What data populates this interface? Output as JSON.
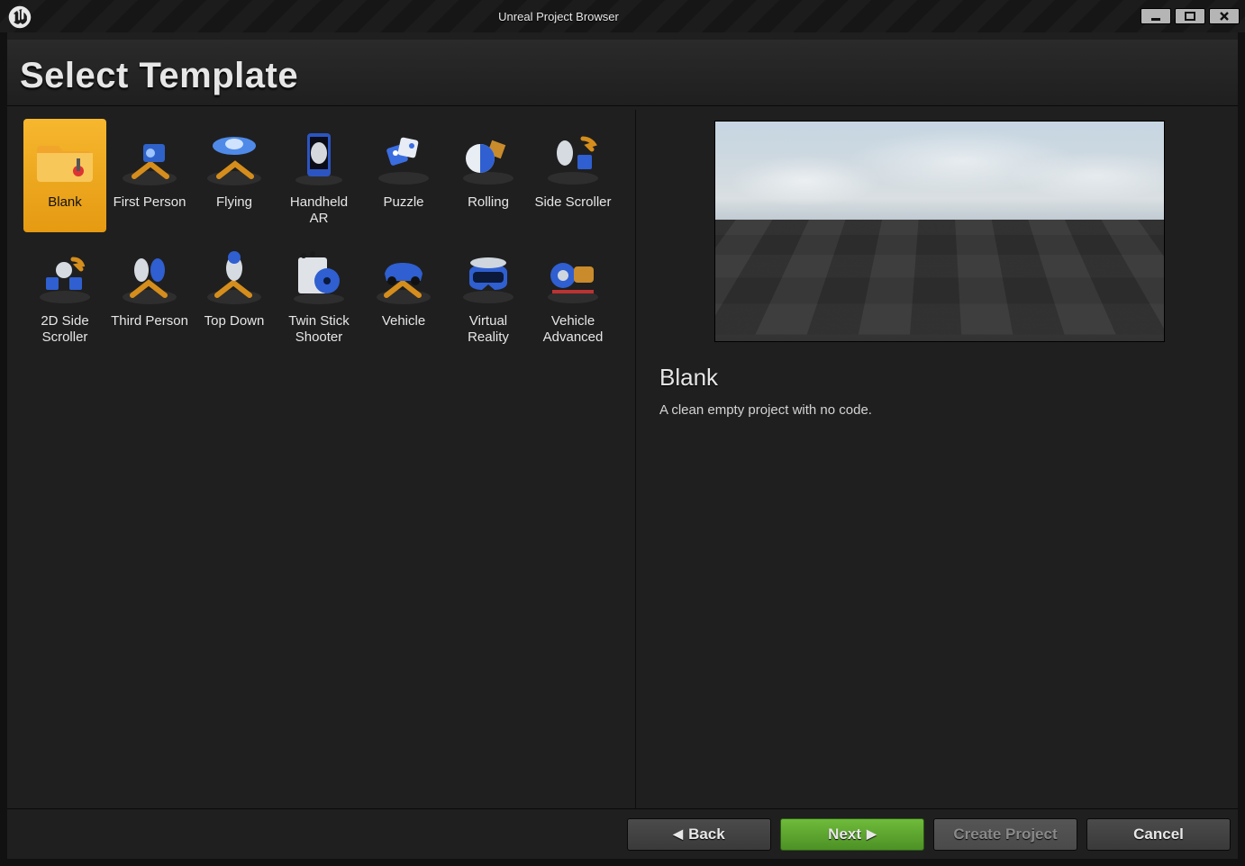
{
  "window_title": "Unreal Project Browser",
  "heading": "Select Template",
  "templates": [
    {
      "label": "Blank",
      "selected": true
    },
    {
      "label": "First Person"
    },
    {
      "label": "Flying"
    },
    {
      "label": "Handheld AR"
    },
    {
      "label": "Puzzle"
    },
    {
      "label": "Rolling"
    },
    {
      "label": "Side Scroller"
    },
    {
      "label": "2D Side Scroller"
    },
    {
      "label": "Third Person"
    },
    {
      "label": "Top Down"
    },
    {
      "label": "Twin Stick Shooter"
    },
    {
      "label": "Vehicle"
    },
    {
      "label": "Virtual Reality"
    },
    {
      "label": "Vehicle Advanced"
    }
  ],
  "detail": {
    "title": "Blank",
    "description": "A clean empty project with no code."
  },
  "buttons": {
    "back": "Back",
    "next": "Next",
    "create_project": "Create Project",
    "cancel": "Cancel"
  }
}
